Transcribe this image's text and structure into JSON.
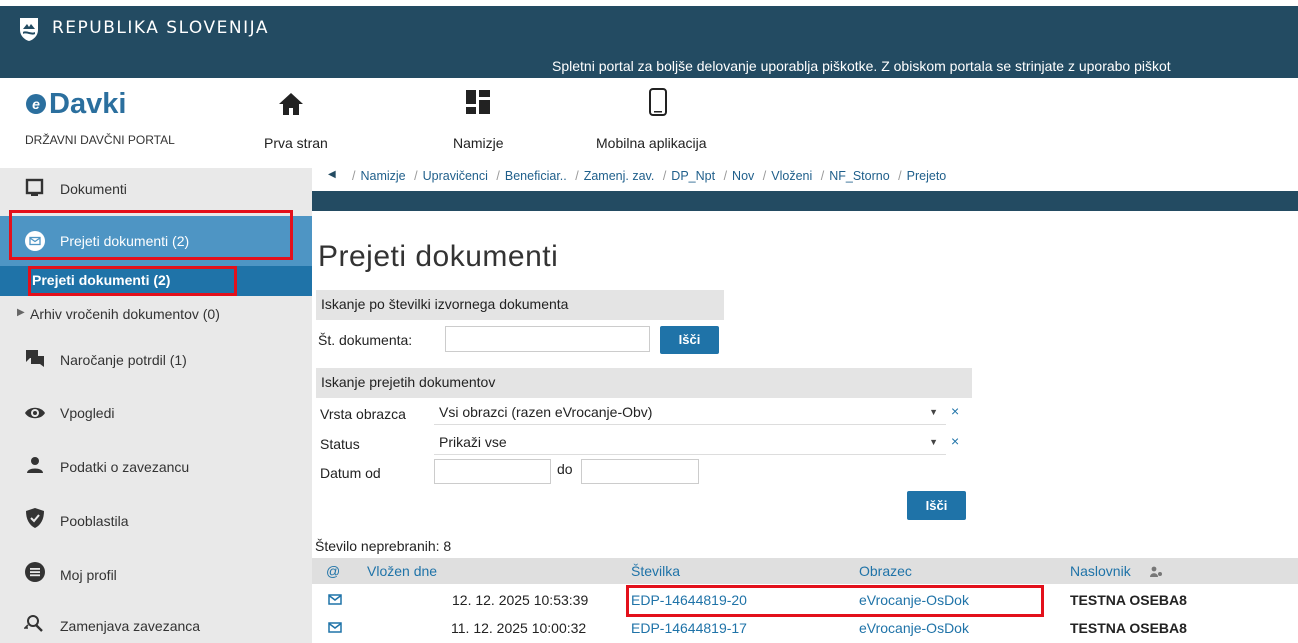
{
  "gov_bar": {
    "name": "REPUBLIKA SLOVENIJA",
    "cookie_notice": "Spletni portal za boljše delovanje uporablja piškotke. Z obiskom portala se strinjate z uporabo piškot"
  },
  "header": {
    "logo": "Davki",
    "portal_subtitle": "DRŽAVNI DAVČNI PORTAL",
    "nav": [
      {
        "label": "Prva stran",
        "icon": "home-icon"
      },
      {
        "label": "Namizje",
        "icon": "dashboard-icon"
      },
      {
        "label": "Mobilna aplikacija",
        "icon": "mobile-icon"
      }
    ]
  },
  "sidebar": {
    "items": [
      {
        "label": "Dokumenti",
        "icon": "document-icon"
      },
      {
        "label": "Prejeti dokumenti (2)",
        "icon": "envelope-icon"
      },
      {
        "label": "Naročanje potrdil (1)",
        "icon": "comments-icon"
      },
      {
        "label": "Vpogledi",
        "icon": "eye-icon"
      },
      {
        "label": "Podatki o zavezancu",
        "icon": "person-icon"
      },
      {
        "label": "Pooblastila",
        "icon": "shield-icon"
      },
      {
        "label": "Moj profil",
        "icon": "list-icon"
      },
      {
        "label": "Zamenjava zavezanca",
        "icon": "switch-user-icon"
      }
    ],
    "sub_active": "Prejeti dokumenti (2)",
    "sub_archive": "Arhiv vročenih dokumentov (0)"
  },
  "breadcrumb": [
    "Namizje",
    "Upravičenci",
    "Beneficiar..",
    "Zamenj. zav.",
    "DP_Npt",
    "Nov",
    "Vloženi",
    "NF_Storno",
    "Prejeto"
  ],
  "main": {
    "title": "Prejeti dokumenti",
    "search_by_number": {
      "heading": "Iskanje po številki izvornega dokumenta",
      "label": "Št. dokumenta:",
      "value": "",
      "button": "Išči"
    },
    "search_received": {
      "heading": "Iskanje prejetih dokumentov",
      "type_label": "Vrsta obrazca",
      "type_value": "Vsi obrazci (razen eVrocanje-Obv)",
      "status_label": "Status",
      "status_value": "Prikaži vse",
      "date_from_label": "Datum od",
      "date_to_label": "do",
      "date_from": "",
      "date_to": "",
      "button": "Išči",
      "clear": "×"
    },
    "unread": "Število neprebranih: 8",
    "table": {
      "columns": [
        "@",
        "Vložen dne",
        "Številka",
        "Obrazec",
        "Naslovnik"
      ],
      "rows": [
        {
          "date": "12. 12. 2025 10:53:39",
          "number": "EDP-14644819-20",
          "form": "eVrocanje-OsDok",
          "recipient": "TESTNA OSEBA8"
        },
        {
          "date": "11. 12. 2025 10:00:32",
          "number": "EDP-14644819-17",
          "form": "eVrocanje-OsDok",
          "recipient": "TESTNA OSEBA8"
        }
      ]
    }
  },
  "colors": {
    "gov_bar": "#234b62",
    "accent": "#1f73a8",
    "highlight": "#e3101b"
  }
}
